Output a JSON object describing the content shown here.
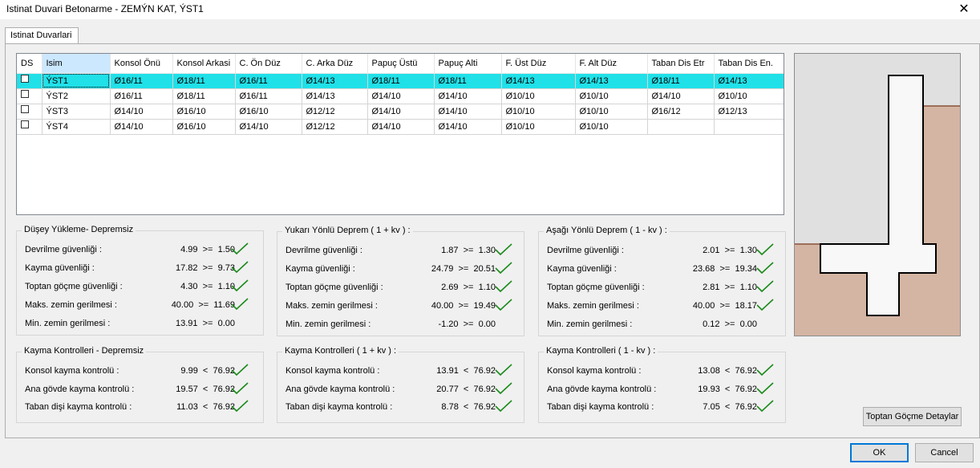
{
  "window": {
    "title": "Istinat Duvari Betonarme - ZEMÝN KAT, ÝST1"
  },
  "tabs": [
    {
      "label": "Istinat Duvarlari"
    }
  ],
  "grid": {
    "columns": [
      "DS",
      "Isim",
      "Konsol Önü",
      "Konsol Arkasi",
      "C. Ön Düz",
      "C. Arka Düz",
      "Papuç Üstü",
      "Papuç Alti",
      "F. Üst Düz",
      "F. Alt Düz",
      "Taban Dis Etr",
      "Taban Dis En."
    ],
    "rows": [
      {
        "checked": false,
        "cells": [
          "ÝST1",
          "Ø16/11",
          "Ø18/11",
          "Ø16/11",
          "Ø14/13",
          "Ø18/11",
          "Ø18/11",
          "Ø14/13",
          "Ø14/13",
          "Ø18/11",
          "Ø14/13"
        ],
        "selected": true
      },
      {
        "checked": false,
        "cells": [
          "ÝST2",
          "Ø16/11",
          "Ø18/11",
          "Ø16/11",
          "Ø14/13",
          "Ø14/10",
          "Ø14/10",
          "Ø10/10",
          "Ø10/10",
          "Ø14/10",
          "Ø10/10"
        ],
        "selected": false
      },
      {
        "checked": false,
        "cells": [
          "ÝST3",
          "Ø14/10",
          "Ø16/10",
          "Ø16/10",
          "Ø12/12",
          "Ø14/10",
          "Ø14/10",
          "Ø10/10",
          "Ø10/10",
          "Ø16/12",
          "Ø12/13"
        ],
        "selected": false
      },
      {
        "checked": false,
        "cells": [
          "ÝST4",
          "Ø14/10",
          "Ø16/10",
          "Ø14/10",
          "Ø12/12",
          "Ø14/10",
          "Ø14/10",
          "Ø10/10",
          "Ø10/10",
          "",
          ""
        ],
        "selected": false
      }
    ]
  },
  "groups": {
    "static": {
      "title": "Düşey Yükleme- Depremsiz",
      "rows": [
        {
          "label": "Devrilme güvenliği :",
          "value": "4.99  >=  1.50",
          "ok": true
        },
        {
          "label": "Kayma güvenliği :",
          "value": "17.82  >=  9.73",
          "ok": true
        },
        {
          "label": "Toptan göçme güvenliği :",
          "value": "4.30  >=  1.10",
          "ok": true
        },
        {
          "label": "Maks. zemin gerilmesi :",
          "value": "40.00  >=  11.69",
          "ok": true
        },
        {
          "label": "Min. zemin gerilmesi :",
          "value": "13.91  >=  0.00",
          "ok": false
        }
      ]
    },
    "up": {
      "title": "Yukarı Yönlü Deprem ( 1 + kv ) :",
      "rows": [
        {
          "label": "Devrilme güvenliği :",
          "value": "1.87  >=  1.30",
          "ok": true
        },
        {
          "label": "Kayma güvenliği :",
          "value": "24.79  >=  20.51",
          "ok": true
        },
        {
          "label": "Toptan göçme güvenliği :",
          "value": "2.69  >=  1.10",
          "ok": true
        },
        {
          "label": "Maks. zemin gerilmesi :",
          "value": "40.00  >=  19.49",
          "ok": true
        },
        {
          "label": "Min. zemin gerilmesi :",
          "value": "-1.20  >=  0.00",
          "ok": false
        }
      ]
    },
    "down": {
      "title": "Aşağı Yönlü Deprem ( 1 - kv ) :",
      "rows": [
        {
          "label": "Devrilme güvenliği :",
          "value": "2.01  >=  1.30",
          "ok": true
        },
        {
          "label": "Kayma güvenliği :",
          "value": "23.68  >=  19.34",
          "ok": true
        },
        {
          "label": "Toptan göçme güvenliği :",
          "value": "2.81  >=  1.10",
          "ok": true
        },
        {
          "label": "Maks. zemin gerilmesi :",
          "value": "40.00  >=  18.17",
          "ok": true
        },
        {
          "label": "Min. zemin gerilmesi :",
          "value": "0.12  >=  0.00",
          "ok": false
        }
      ]
    },
    "slide_static": {
      "title": "Kayma Kontrolleri - Depremsiz",
      "rows": [
        {
          "label": "Konsol kayma kontrolü :",
          "value": "9.99  <  76.92",
          "ok": true
        },
        {
          "label": "Ana gövde kayma kontrolü :",
          "value": "19.57  <  76.92",
          "ok": true
        },
        {
          "label": "Taban dişi kayma kontrolü :",
          "value": "11.03  <  76.92",
          "ok": true
        }
      ]
    },
    "slide_up": {
      "title": "Kayma Kontrolleri ( 1 + kv ) :",
      "rows": [
        {
          "label": "Konsol kayma kontrolü :",
          "value": "13.91  <  76.92",
          "ok": true
        },
        {
          "label": "Ana gövde kayma kontrolü :",
          "value": "20.77  <  76.92",
          "ok": true
        },
        {
          "label": "Taban dişi kayma kontrolü :",
          "value": "8.78  <  76.92",
          "ok": true
        }
      ]
    },
    "slide_down": {
      "title": "Kayma Kontrolleri ( 1 - kv ) :",
      "rows": [
        {
          "label": "Konsol kayma kontrolü :",
          "value": "13.08  <  76.92",
          "ok": true
        },
        {
          "label": "Ana gövde kayma kontrolü :",
          "value": "19.93  <  76.92",
          "ok": true
        },
        {
          "label": "Taban dişi kayma kontrolü :",
          "value": "7.05  <  76.92",
          "ok": true
        }
      ]
    }
  },
  "buttons": {
    "detail": "Toptan Göçme Detaylar",
    "ok": "OK",
    "cancel": "Cancel"
  },
  "colors": {
    "selected_row": "#20e0e8",
    "soil": "#d4b5a3",
    "check": "#1a8a1a"
  },
  "icons": {
    "check": "check-icon",
    "close": "close-icon"
  }
}
